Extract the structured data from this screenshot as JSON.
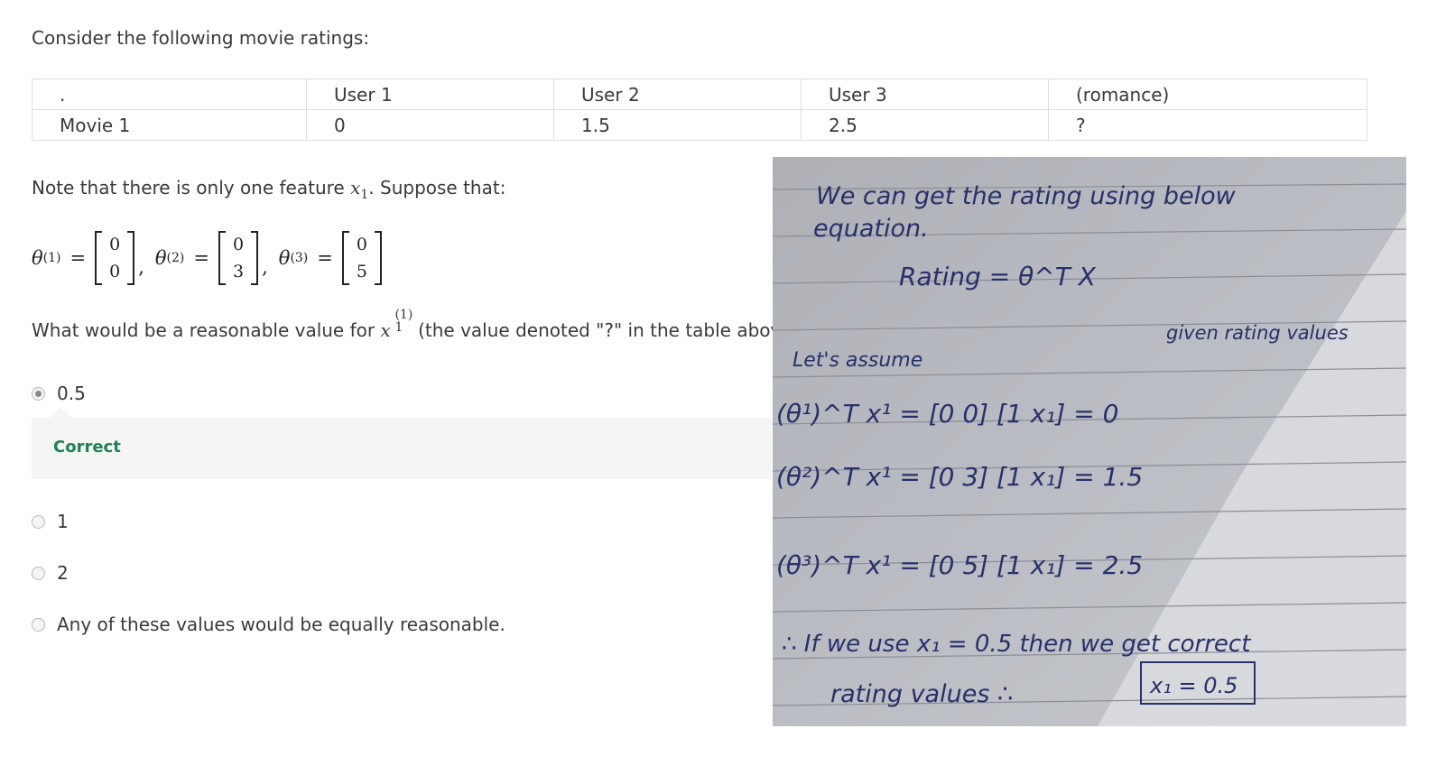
{
  "intro": "Consider the following movie ratings:",
  "table": {
    "header": [
      ".",
      "User 1",
      "User 2",
      "User 3",
      "(romance)"
    ],
    "rows": [
      [
        "Movie 1",
        "0",
        "1.5",
        "2.5",
        "?"
      ]
    ]
  },
  "note": {
    "before": "Note that there is only one feature",
    "var": "x",
    "sub": "1",
    "after": ". Suppose that:"
  },
  "thetas": [
    {
      "label": "θ",
      "sup": "(1)",
      "values": [
        "0",
        "0"
      ]
    },
    {
      "label": "θ",
      "sup": "(2)",
      "values": [
        "0",
        "3"
      ]
    },
    {
      "label": "θ",
      "sup": "(3)",
      "values": [
        "0",
        "5"
      ]
    }
  ],
  "question": {
    "before": "What would be a reasonable value for",
    "var": "x",
    "sup": "(1)",
    "sub": "1",
    "after": "(the value denoted \"?\" in the table above)?"
  },
  "options": [
    {
      "label": "0.5",
      "selected": true
    },
    {
      "label": "1",
      "selected": false
    },
    {
      "label": "2",
      "selected": false
    },
    {
      "label": "Any of these values would be equally reasonable.",
      "selected": false
    }
  ],
  "feedback": {
    "label": "Correct",
    "color": "#1f8354"
  },
  "handwritten_note": {
    "lines": [
      "We can get the rating using below",
      "equation.",
      "Rating = θ^T X",
      "given rating values",
      "Let's assume",
      "(θ¹)^T x¹ = [0 0] [1 x₁] = 0",
      "(θ²)^T x¹ = [0 3] [1 x₁] = 1.5",
      "(θ³)^T x¹ = [0 5] [1 x₁] = 2.5",
      "∴ If we use x₁ = 0.5 then we get correct",
      "rating values ∴",
      "x₁ = 0.5"
    ]
  }
}
